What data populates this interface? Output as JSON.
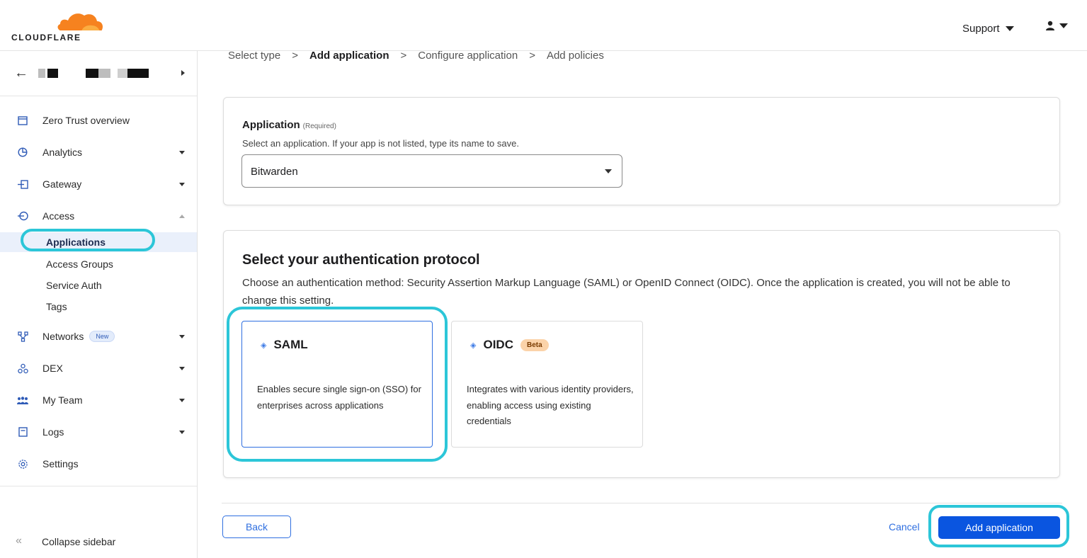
{
  "brand": {
    "logo_text": "CLOUDFLARE",
    "accent": "#f6821f"
  },
  "header": {
    "support_label": "Support"
  },
  "sidebar": {
    "items": [
      {
        "label": "Zero Trust overview",
        "icon": "browser-window-icon"
      },
      {
        "label": "Analytics",
        "icon": "pie-chart-icon"
      },
      {
        "label": "Gateway",
        "icon": "gateway-icon"
      },
      {
        "label": "Access",
        "icon": "access-icon"
      },
      {
        "label": "Networks",
        "icon": "network-icon",
        "badge": "New"
      },
      {
        "label": "DEX",
        "icon": "dex-icon"
      },
      {
        "label": "My Team",
        "icon": "team-icon"
      },
      {
        "label": "Logs",
        "icon": "logs-icon"
      },
      {
        "label": "Settings",
        "icon": "gear-icon"
      }
    ],
    "access_sub": [
      "Applications",
      "Access Groups",
      "Service Auth",
      "Tags"
    ],
    "collapse_label": "Collapse sidebar"
  },
  "breadcrumb": [
    "Select type",
    "Add application",
    "Configure application",
    "Add policies"
  ],
  "breadcrumb_separator": ">",
  "application": {
    "title": "Application",
    "required": "(Required)",
    "help": "Select an application. If your app is not listed, type its name to save.",
    "selected": "Bitwarden"
  },
  "protocol": {
    "title": "Select your authentication protocol",
    "description": "Choose an authentication method: Security Assertion Markup Language (SAML) or OpenID Connect (OIDC). Once the application is created, you will not be able to change this setting.",
    "options": [
      {
        "name": "SAML",
        "desc": "Enables secure single sign-on (SSO) for enterprises across applications",
        "selected": true
      },
      {
        "name": "OIDC",
        "badge": "Beta",
        "desc": "Integrates with various identity providers, enabling access using existing credentials",
        "selected": false
      }
    ]
  },
  "footer": {
    "back": "Back",
    "cancel": "Cancel",
    "add": "Add application"
  },
  "colors": {
    "primary": "#0a55e0",
    "highlight": "#2cc6d8",
    "beta_badge": "#fbd3a9"
  }
}
